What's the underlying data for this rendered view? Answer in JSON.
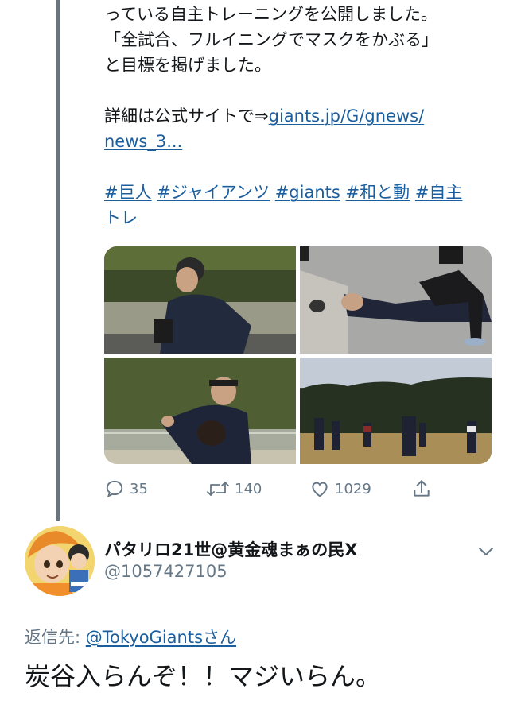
{
  "tweet": {
    "lines": [
      "っている自主トレーニングを公開しました。",
      "「全試合、フルイニングでマスクをかぶる」",
      "と目標を掲げました。"
    ],
    "details_prefix": "詳細は公式サイトで⇒",
    "details_link": "giants.jp/G/gnews/",
    "details_link_cont": "news_3...",
    "hashtags": [
      "#巨人",
      "#ジャイアンツ",
      "#giants",
      "#和と動",
      "#自主",
      "トレ"
    ]
  },
  "actions": {
    "reply_count": "35",
    "retweet_count": "140",
    "like_count": "1029"
  },
  "reply": {
    "display_name": "パタリロ21世@黄金魂まぁの民X",
    "handle": "@1057427105",
    "reply_to_prefix": "返信先: ",
    "reply_to_mention": "@TokyoGiantsさん",
    "body": "炭谷入らんぞ！！マジいらん。"
  },
  "colors": {
    "link": "#1b5e9e",
    "secondary_text": "#657786",
    "thread_line": "#66757f"
  },
  "icons": [
    "reply-icon",
    "retweet-icon",
    "like-icon",
    "share-icon",
    "chevron-down-icon"
  ]
}
